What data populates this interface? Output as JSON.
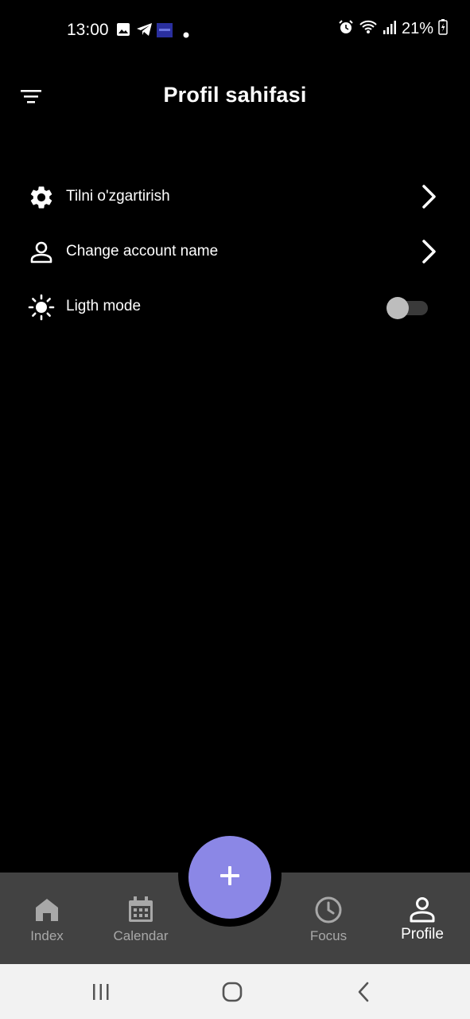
{
  "status_bar": {
    "time": "13:00",
    "left_icons": [
      "image-icon",
      "telegram-icon",
      "app-badge-icon",
      "dot-icon"
    ],
    "right_icons": [
      "alarm-icon",
      "wifi-icon",
      "signal-icon",
      "battery-charging-icon"
    ],
    "battery": "21%"
  },
  "header": {
    "menu_icon": "filter-menu-icon",
    "title": "Profil sahifasi"
  },
  "settings": {
    "items": [
      {
        "icon": "gear-icon",
        "label": "Tilni o'zgartirish",
        "trailing": "chevron-right-icon"
      },
      {
        "icon": "person-icon",
        "label": "Change account name",
        "trailing": "chevron-right-icon"
      },
      {
        "icon": "sun-icon",
        "label": "Ligth mode",
        "trailing": "switch",
        "switch_on": false
      }
    ]
  },
  "fab": {
    "icon": "plus-icon"
  },
  "bottom_nav": {
    "items": [
      {
        "icon": "home-icon",
        "label": "Index",
        "active": false
      },
      {
        "icon": "calendar-icon",
        "label": "Calendar",
        "active": false
      },
      {
        "icon": "clock-icon",
        "label": "Focus",
        "active": false
      },
      {
        "icon": "person-icon",
        "label": "Profile",
        "active": true
      }
    ]
  },
  "system_nav": {
    "buttons": [
      "recents-icon",
      "home-circle-icon",
      "back-icon"
    ]
  },
  "colors": {
    "background": "#000000",
    "nav_bar": "#424242",
    "fab": "#8b87e6",
    "inactive_label": "#a8a8a8",
    "system_bar": "#f2f2f2"
  }
}
